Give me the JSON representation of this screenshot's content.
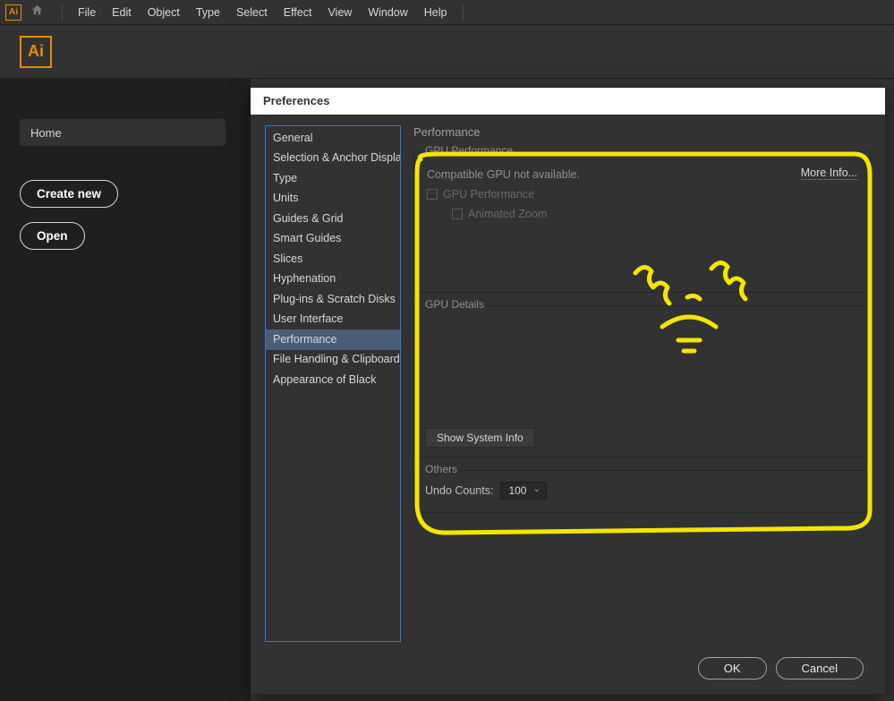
{
  "menubar": {
    "items": [
      "File",
      "Edit",
      "Object",
      "Type",
      "Select",
      "Effect",
      "View",
      "Window",
      "Help"
    ]
  },
  "home": {
    "label": "Home",
    "create_new": "Create new",
    "open": "Open"
  },
  "prefs": {
    "title": "Preferences",
    "categories": [
      "General",
      "Selection & Anchor Display",
      "Type",
      "Units",
      "Guides & Grid",
      "Smart Guides",
      "Slices",
      "Hyphenation",
      "Plug-ins & Scratch Disks",
      "User Interface",
      "Performance",
      "File Handling & Clipboard",
      "Appearance of Black"
    ],
    "selected_index": 10,
    "panel_title": "Performance",
    "gpu": {
      "group_label": "GPU Performance",
      "msg": "Compatible GPU not available.",
      "more_info": "More Info...",
      "chk_gpu": "GPU Performance",
      "chk_zoom": "Animated Zoom"
    },
    "details": {
      "group_label": "GPU Details",
      "sys_btn": "Show System Info"
    },
    "others": {
      "group_label": "Others",
      "undo_label": "Undo Counts:",
      "undo_value": "100"
    },
    "ok": "OK",
    "cancel": "Cancel"
  }
}
